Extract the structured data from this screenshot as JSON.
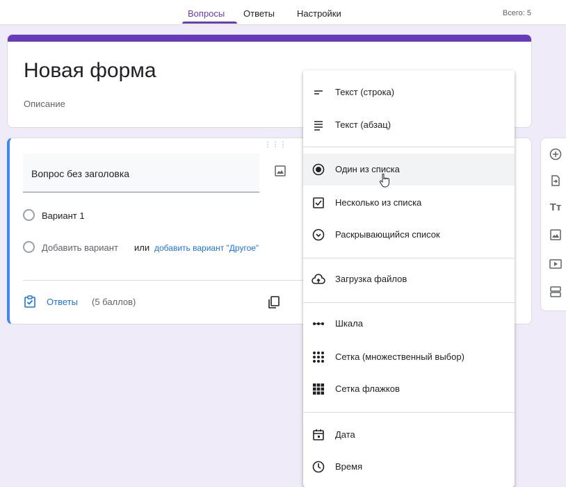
{
  "tabs": {
    "questions": "Вопросы",
    "answers": "Ответы",
    "settings": "Настройки"
  },
  "total": "Всего: 5",
  "form": {
    "title": "Новая форма",
    "description": "Описание"
  },
  "question": {
    "title": "Вопрос без заголовка",
    "option1": "Вариант 1",
    "add_option": "Добавить вариант",
    "or": "или",
    "add_other": "добавить вариант \"Другое\"",
    "answers_label": "Ответы",
    "points": "(5 баллов)"
  },
  "menu": {
    "items": [
      {
        "label": "Текст (строка)",
        "icon": "short-text-icon"
      },
      {
        "label": "Текст (абзац)",
        "icon": "paragraph-icon"
      },
      {
        "label": "Один из списка",
        "icon": "radio-icon",
        "hovered": true
      },
      {
        "label": "Несколько из списка",
        "icon": "checkbox-icon"
      },
      {
        "label": "Раскрывающийся список",
        "icon": "dropdown-icon"
      },
      {
        "label": "Загрузка файлов",
        "icon": "cloud-upload-icon"
      },
      {
        "label": "Шкала",
        "icon": "linear-scale-icon"
      },
      {
        "label": "Сетка (множественный выбор)",
        "icon": "grid-dots-icon"
      },
      {
        "label": "Сетка флажков",
        "icon": "grid-squares-icon"
      },
      {
        "label": "Дата",
        "icon": "calendar-icon"
      },
      {
        "label": "Время",
        "icon": "clock-icon"
      }
    ]
  },
  "sidebar": {
    "icons": [
      "add-question-icon",
      "import-icon",
      "title-text-icon",
      "image-icon",
      "video-icon",
      "section-icon"
    ],
    "title_glyph": "Tт"
  },
  "colors": {
    "accent": "#673ab7",
    "active_blue": "#4285f4",
    "link": "#1a73e8"
  }
}
